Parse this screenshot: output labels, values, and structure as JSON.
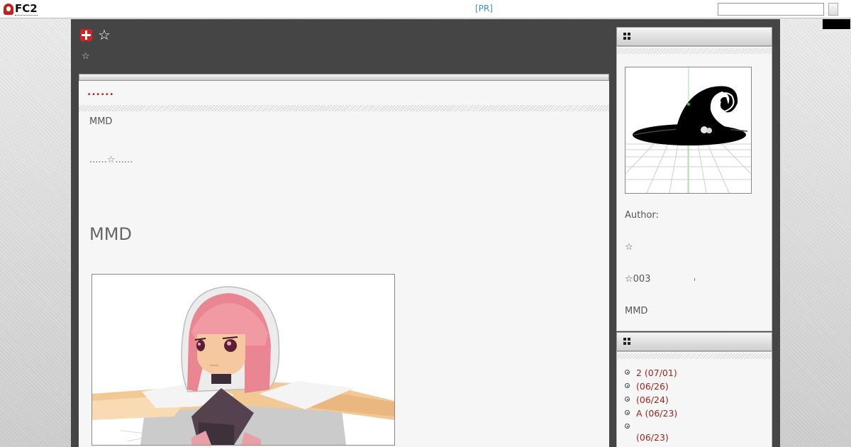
{
  "topbar": {
    "logo_text": "FC2",
    "pr_label": "[PR]",
    "search_value": "",
    "search_button_label": ""
  },
  "header": {
    "star": "☆",
    "sub_star": "☆"
  },
  "entry": {
    "title": "......",
    "category": "MMD",
    "line": "......☆......",
    "heading": "MMD"
  },
  "sidebar": {
    "profile": {
      "author_label": "Author:",
      "star_line": "☆",
      "code_line": "☆003",
      "tag_line": "MMD"
    },
    "recent_entries": [
      {
        "label": "2 (07/01)"
      },
      {
        "label": " (06/26)"
      },
      {
        "label": " (06/24)"
      },
      {
        "label": "A (06/23)"
      },
      {
        "label": "(06/23)"
      }
    ]
  },
  "colors": {
    "accent_red": "#b22a10",
    "link_blue": "#3d8fd6",
    "frame_dark": "#454545"
  }
}
